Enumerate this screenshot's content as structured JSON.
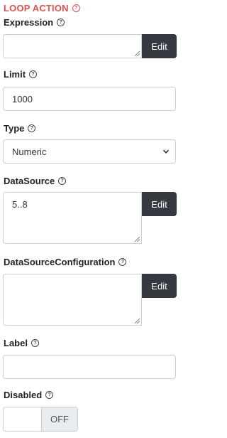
{
  "section": {
    "title": "LOOP ACTION"
  },
  "fields": {
    "expression": {
      "label": "Expression",
      "value": "",
      "edit_label": "Edit"
    },
    "limit": {
      "label": "Limit",
      "value": "1000"
    },
    "type": {
      "label": "Type",
      "selected": "Numeric"
    },
    "datasource": {
      "label": "DataSource",
      "value": "5..8",
      "edit_label": "Edit"
    },
    "datasource_configuration": {
      "label": "DataSourceConfiguration",
      "value": "",
      "edit_label": "Edit"
    },
    "label": {
      "label": "Label",
      "value": ""
    },
    "disabled": {
      "label": "Disabled",
      "state": "OFF"
    }
  },
  "icons": {
    "help": "help-circle-icon",
    "select": "chevron-down-icon"
  },
  "colors": {
    "section_title": "#d9534f",
    "edit_button": "#343a40",
    "toggle_off": "#e9ecef"
  }
}
